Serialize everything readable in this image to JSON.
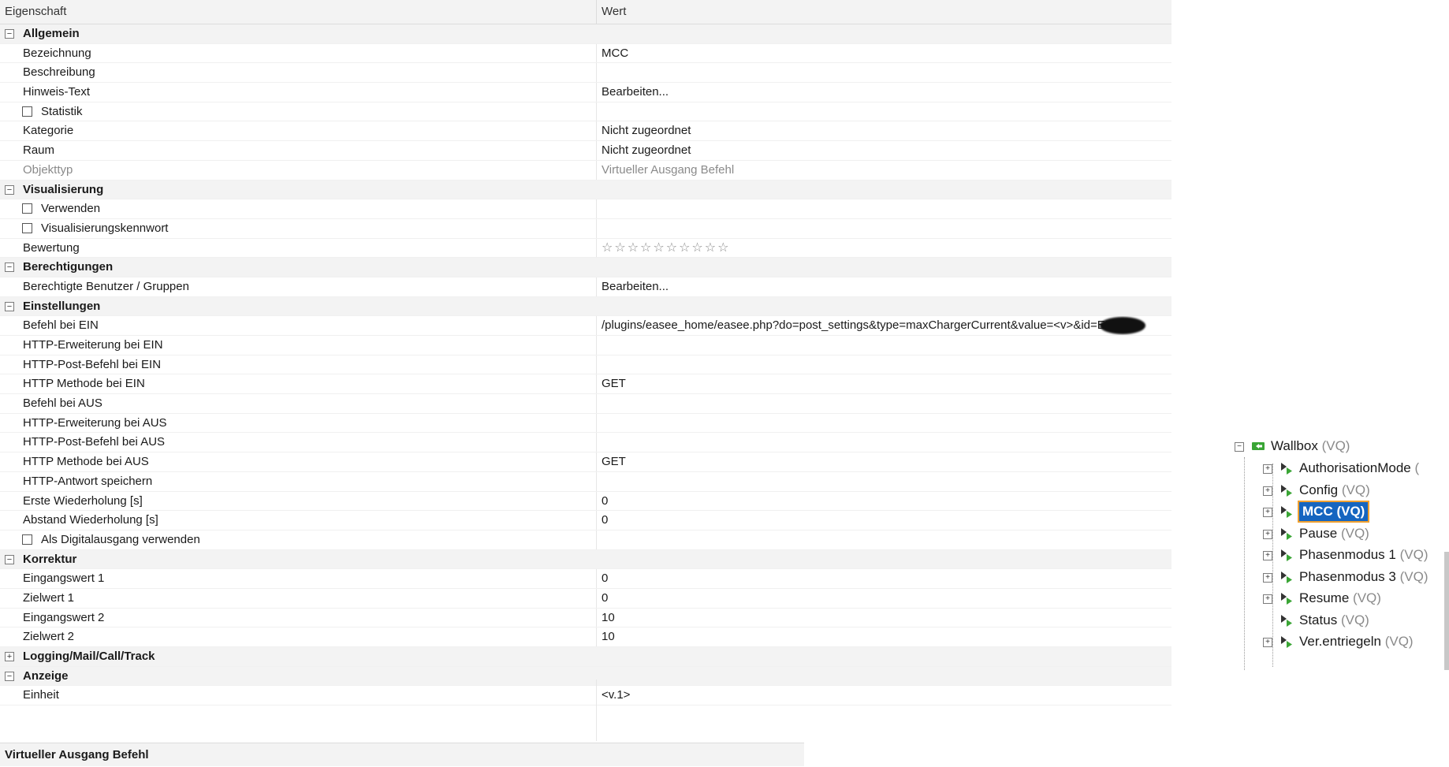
{
  "header": {
    "col_property": "Eigenschaft",
    "col_value": "Wert"
  },
  "rows": [
    {
      "kind": "section",
      "expander": "−",
      "label": "Allgemein"
    },
    {
      "kind": "item",
      "label": "Bezeichnung",
      "value": "MCC"
    },
    {
      "kind": "item",
      "label": "Beschreibung",
      "value": ""
    },
    {
      "kind": "item",
      "label": "Hinweis-Text",
      "value": "Bearbeiten..."
    },
    {
      "kind": "check",
      "label": "Statistik",
      "value": ""
    },
    {
      "kind": "item",
      "label": "Kategorie",
      "value": "Nicht zugeordnet"
    },
    {
      "kind": "item",
      "label": "Raum",
      "value": "Nicht zugeordnet"
    },
    {
      "kind": "item-dim",
      "label": "Objekttyp",
      "value": "Virtueller Ausgang Befehl"
    },
    {
      "kind": "section",
      "expander": "−",
      "label": "Visualisierung"
    },
    {
      "kind": "check",
      "label": "Verwenden",
      "value": ""
    },
    {
      "kind": "check",
      "label": "Visualisierungskennwort",
      "value": ""
    },
    {
      "kind": "stars",
      "label": "Bewertung",
      "value": "☆☆☆☆☆☆☆☆☆☆"
    },
    {
      "kind": "section",
      "expander": "−",
      "label": "Berechtigungen"
    },
    {
      "kind": "item",
      "label": "Berechtigte Benutzer / Gruppen",
      "value": "Bearbeiten..."
    },
    {
      "kind": "section",
      "expander": "−",
      "label": "Einstellungen"
    },
    {
      "kind": "item-redacted",
      "label": "Befehl bei EIN",
      "value": "/plugins/easee_home/easee.php?do=post_settings&type=maxChargerCurrent&value=<v>&id=EH"
    },
    {
      "kind": "item",
      "label": "HTTP-Erweiterung bei EIN",
      "value": ""
    },
    {
      "kind": "item",
      "label": "HTTP-Post-Befehl bei EIN",
      "value": ""
    },
    {
      "kind": "item",
      "label": "HTTP Methode bei EIN",
      "value": "GET"
    },
    {
      "kind": "item",
      "label": "Befehl bei AUS",
      "value": ""
    },
    {
      "kind": "item",
      "label": "HTTP-Erweiterung bei AUS",
      "value": ""
    },
    {
      "kind": "item",
      "label": "HTTP-Post-Befehl bei AUS",
      "value": ""
    },
    {
      "kind": "item",
      "label": "HTTP Methode bei AUS",
      "value": "GET"
    },
    {
      "kind": "item",
      "label": "HTTP-Antwort speichern",
      "value": ""
    },
    {
      "kind": "item",
      "label": "Erste Wiederholung [s]",
      "value": "0"
    },
    {
      "kind": "item",
      "label": "Abstand Wiederholung [s]",
      "value": "0"
    },
    {
      "kind": "check",
      "label": "Als Digitalausgang verwenden",
      "value": ""
    },
    {
      "kind": "section",
      "expander": "−",
      "label": "Korrektur"
    },
    {
      "kind": "item",
      "label": "Eingangswert 1",
      "value": "0"
    },
    {
      "kind": "item",
      "label": "Zielwert 1",
      "value": "0"
    },
    {
      "kind": "item",
      "label": "Eingangswert 2",
      "value": "10"
    },
    {
      "kind": "item",
      "label": "Zielwert 2",
      "value": "10"
    },
    {
      "kind": "section",
      "expander": "+",
      "label": "Logging/Mail/Call/Track"
    },
    {
      "kind": "section",
      "expander": "−",
      "label": "Anzeige"
    },
    {
      "kind": "item",
      "label": "Einheit",
      "value": "<v.1>"
    }
  ],
  "status_bar": {
    "text": "Virtueller Ausgang Befehl"
  },
  "tree": {
    "root": {
      "name": "Wallbox",
      "type": "(VQ)",
      "expander": "−"
    },
    "children": [
      {
        "name": "AuthorisationMode",
        "type": "(",
        "expander": "+",
        "selected": false
      },
      {
        "name": "Config",
        "type": "(VQ)",
        "expander": "+",
        "selected": false
      },
      {
        "name": "MCC",
        "type": "(VQ)",
        "expander": "+",
        "selected": true
      },
      {
        "name": "Pause",
        "type": "(VQ)",
        "expander": "+",
        "selected": false
      },
      {
        "name": "Phasenmodus 1",
        "type": "(VQ)",
        "expander": "+",
        "selected": false
      },
      {
        "name": "Phasenmodus 3",
        "type": "(VQ)",
        "expander": "+",
        "selected": false
      },
      {
        "name": "Resume",
        "type": "(VQ)",
        "expander": "+",
        "selected": false
      },
      {
        "name": "Status",
        "type": "(VQ)",
        "expander": "",
        "selected": false
      },
      {
        "name": "Ver.entriegeln",
        "type": "(VQ)",
        "expander": "+",
        "selected": false
      }
    ],
    "icon_color_root": "#3aa535",
    "icon_color_child": "#3aa535",
    "selection_color": "#1565c0"
  }
}
